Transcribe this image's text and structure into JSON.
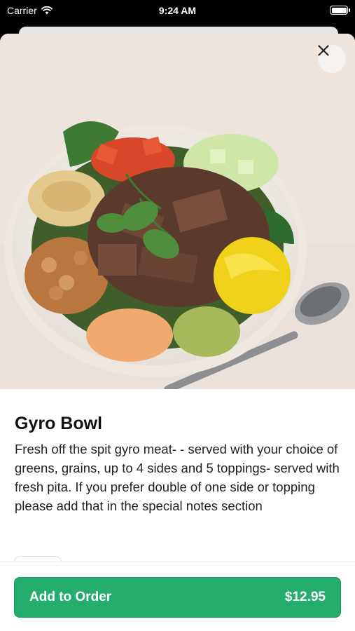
{
  "status_bar": {
    "carrier": "Carrier",
    "time": "9:24 AM"
  },
  "item": {
    "title": "Gyro Bowl",
    "description": "Fresh off the spit gyro meat- - served with your choice of greens, grains, up to 4 sides and 5 toppings- served with fresh pita. If you prefer double of one side or topping please add that in the special notes section",
    "image_icon": "gyro-bowl-photo"
  },
  "footer": {
    "add_label": "Add to Order",
    "price": "$12.95"
  },
  "colors": {
    "accent": "#25ad6d",
    "text": "#111111",
    "sheet": "#ffffff"
  }
}
